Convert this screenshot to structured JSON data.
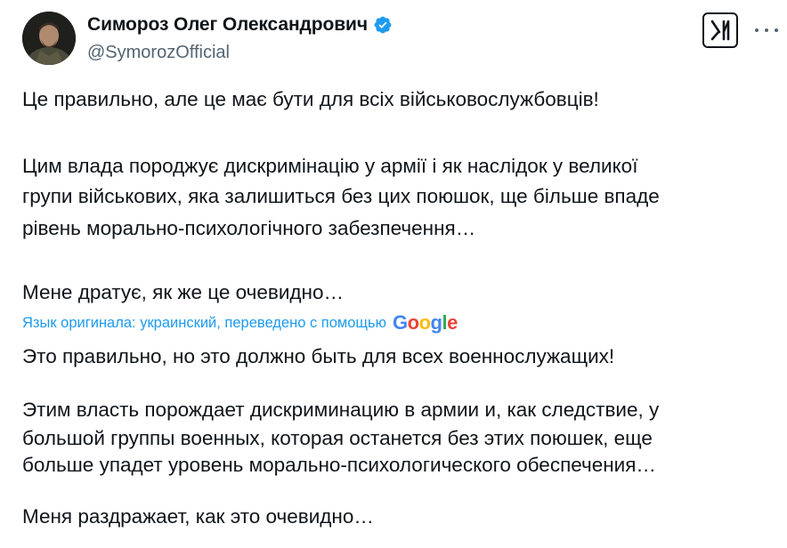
{
  "author": {
    "display_name": "Симороз Олег Олександрович",
    "handle": "@SymorozOfficial",
    "verified": true,
    "avatar_icon": "profile-photo"
  },
  "header_icons": {
    "logo": "x-logo-icon",
    "more": "more-options-icon"
  },
  "original_text": {
    "line_1": "Це правильно, але це має бути для всіх військовослужбовців!",
    "line_2": "Цим влада породжує дискримінацію у армії і як наслідок у великої",
    "line_3": "групи військових, яка залишиться без цих поюшок, ще більше впаде",
    "line_4": "рівень морально-психологічного забезпечення…",
    "line_5": "Мене дратує, як же це очевидно…"
  },
  "translation_note": {
    "label": "Язык оригинала: украинский, переведено с помощью",
    "provider": "Google"
  },
  "translated_text": {
    "line_1": "Это правильно, но это должно быть для всех военнослужащих!",
    "line_2": "Этим власть порождает дискриминацию в армии и, как следствие, у",
    "line_3": "большой группы военных, которая останется без этих поюшек, еще",
    "line_4": "больше упадет уровень морально-психологического обеспечения…",
    "line_5": "Меня раздражает, как это очевидно…"
  },
  "colors": {
    "text": "#0f1419",
    "secondary": "#536471",
    "link": "#1d9bf0",
    "verified_badge": "#1d9bf0"
  }
}
